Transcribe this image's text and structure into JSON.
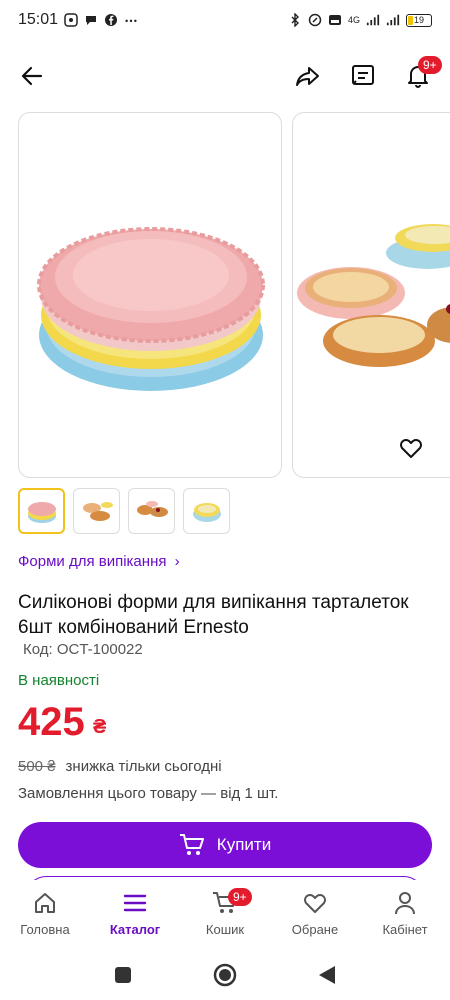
{
  "status_bar": {
    "time": "15:01",
    "battery": "19",
    "network": "4G"
  },
  "app_bar": {
    "notification_badge": "9+"
  },
  "gallery": {
    "thumbnails": [
      {
        "icon": "pink-stack-thumb"
      },
      {
        "icon": "tarts-thumb"
      },
      {
        "icon": "tarts-berries-thumb"
      },
      {
        "icon": "yellow-mould-thumb"
      }
    ]
  },
  "product": {
    "category": "Форми для випікання",
    "title": "Силіконові форми для випікання тарталеток 6шт комбінований Ernesto",
    "sku": "Код: OCT-100022",
    "stock": "В наявності",
    "price": "425",
    "currency": "₴",
    "old_price": "500 ₴",
    "discount_text": "знижка тільки сьогодні",
    "min_order": "Замовлення цього товару — від 1 шт."
  },
  "actions": {
    "buy_label": "Купити"
  },
  "bottom_nav": {
    "items": [
      {
        "label": "Головна",
        "icon": "home-icon"
      },
      {
        "label": "Каталог",
        "icon": "menu-icon"
      },
      {
        "label": "Кошик",
        "icon": "cart-icon",
        "badge": "9+"
      },
      {
        "label": "Обране",
        "icon": "heart-icon"
      },
      {
        "label": "Кабінет",
        "icon": "user-icon"
      }
    ],
    "active_index": 1
  },
  "colors": {
    "accent": "#7b0fd8",
    "price": "#e21b2d",
    "stock": "#13812d",
    "badge": "#e21b2d"
  }
}
